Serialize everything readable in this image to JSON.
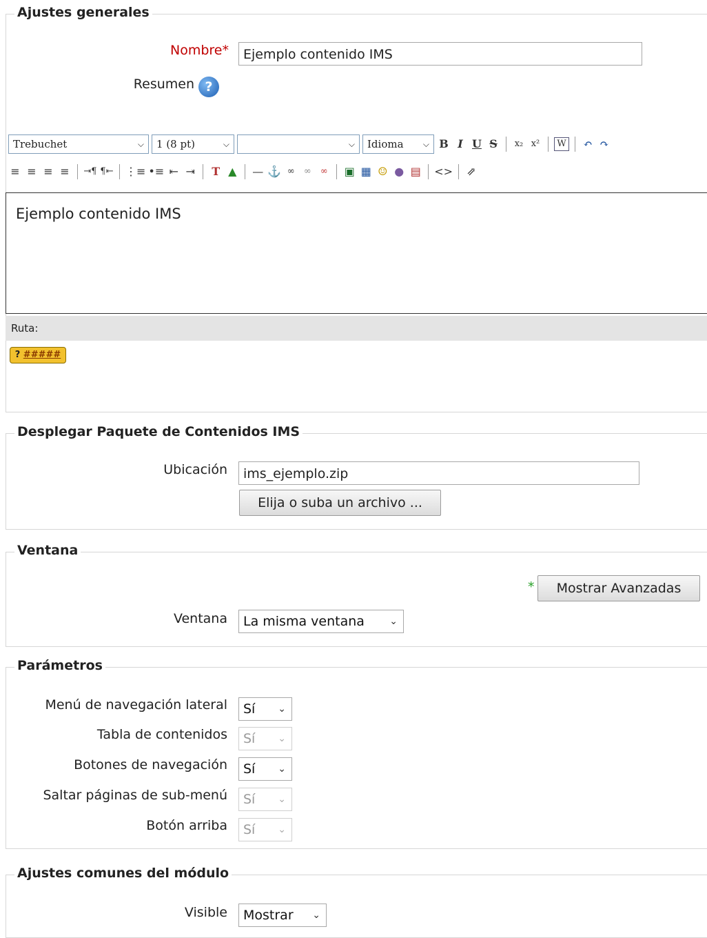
{
  "general": {
    "legend": "Ajustes generales",
    "name_label": "Nombre",
    "name_required": "*",
    "name_value": "Ejemplo contenido IMS",
    "summary_label": "Resumen",
    "help_icon": "?"
  },
  "editor": {
    "font_family": "Trebuchet",
    "font_size": "1 (8 pt)",
    "format": "",
    "language": "Idioma",
    "content": "Ejemplo contenido IMS",
    "path_label": "Ruta:",
    "keyboard_help": "?"
  },
  "deploy": {
    "legend": "Desplegar Paquete de Contenidos IMS",
    "location_label": "Ubicación",
    "location_value": "ims_ejemplo.zip",
    "choose_button": "Elija o suba un archivo ..."
  },
  "window": {
    "legend": "Ventana",
    "advanced_star": "*",
    "advanced_button": "Mostrar Avanzadas",
    "window_label": "Ventana",
    "window_value": "La misma ventana"
  },
  "params": {
    "legend": "Parámetros",
    "rows": [
      {
        "label": "Menú de navegación lateral",
        "value": "Sí",
        "disabled": false
      },
      {
        "label": "Tabla de contenidos",
        "value": "Sí",
        "disabled": true
      },
      {
        "label": "Botones de navegación",
        "value": "Sí",
        "disabled": false
      },
      {
        "label": "Saltar páginas de sub-menú",
        "value": "Sí",
        "disabled": true
      },
      {
        "label": "Botón arriba",
        "value": "Sí",
        "disabled": true
      }
    ]
  },
  "common": {
    "legend": "Ajustes comunes del módulo",
    "visible_label": "Visible",
    "visible_value": "Mostrar"
  }
}
